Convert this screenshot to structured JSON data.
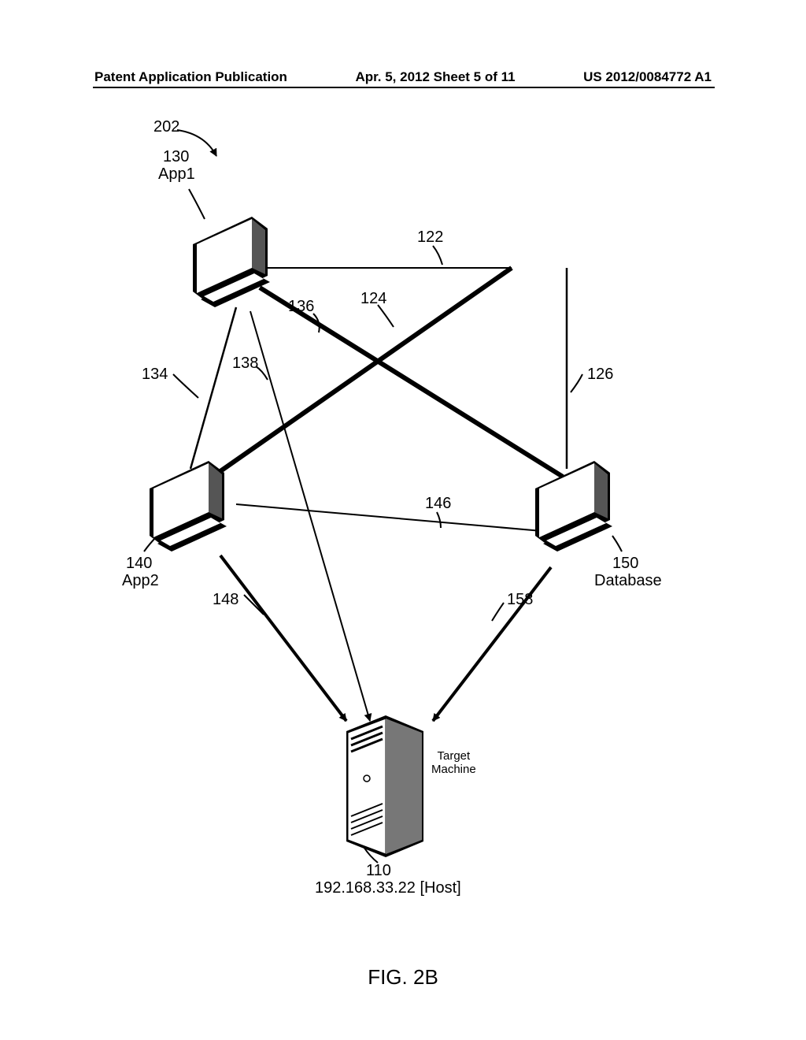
{
  "header": {
    "left": "Patent Application Publication",
    "center": "Apr. 5, 2012  Sheet 5 of 11",
    "right": "US 2012/0084772 A1"
  },
  "diagram": {
    "ref_202": "202",
    "node_130_num": "130",
    "node_130_name": "App1",
    "ref_122": "122",
    "ref_124": "124",
    "ref_126": "126",
    "ref_134": "134",
    "ref_136": "136",
    "ref_138": "138",
    "node_140_num": "140",
    "node_140_name": "App2",
    "ref_146": "146",
    "ref_148": "148",
    "node_150_num": "150",
    "node_150_name": "Database",
    "ref_158": "158",
    "target_label": "Target\nMachine",
    "node_110_num": "110",
    "node_110_ip": "192.168.33.22 [Host]",
    "figure_label": "FIG. 2B"
  }
}
